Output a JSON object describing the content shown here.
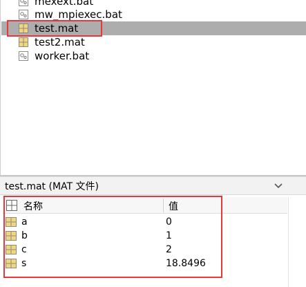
{
  "file_list": {
    "items": [
      {
        "name": "mexext.bat",
        "icon": "bat-file-icon",
        "selected": false
      },
      {
        "name": "mw_mpiexec.bat",
        "icon": "bat-file-icon",
        "selected": false
      },
      {
        "name": "test.mat",
        "icon": "mat-file-icon",
        "selected": true
      },
      {
        "name": "test2.mat",
        "icon": "mat-file-icon",
        "selected": false
      },
      {
        "name": "worker.bat",
        "icon": "bat-file-icon",
        "selected": false
      }
    ]
  },
  "details": {
    "title": "test.mat  (MAT 文件)",
    "collapse_icon": "chevron-down-icon",
    "columns": {
      "name": "名称",
      "value": "值"
    },
    "variables": [
      {
        "name": "a",
        "value": "0"
      },
      {
        "name": "b",
        "value": "1"
      },
      {
        "name": "c",
        "value": "2"
      },
      {
        "name": "s",
        "value": "18.8496"
      }
    ]
  },
  "colors": {
    "highlight": "#e8363b",
    "selection": "#adadad",
    "mat_icon_fill": "#f3d67a"
  }
}
